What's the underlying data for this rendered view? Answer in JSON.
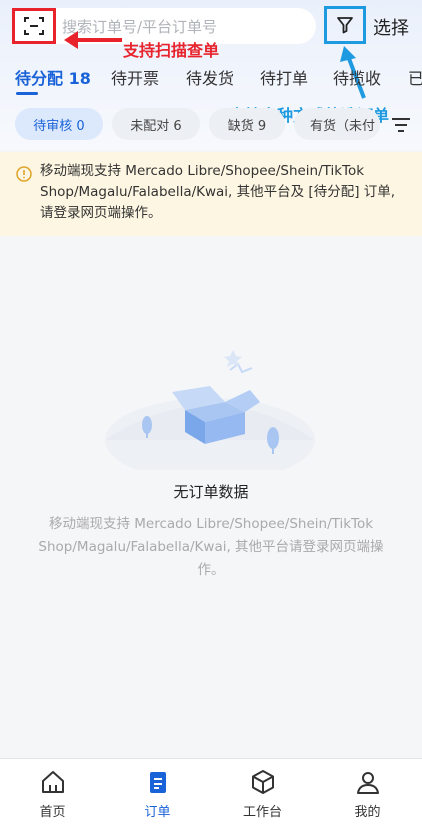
{
  "header": {
    "search_placeholder": "搜索订单号/平台订单号",
    "select_label": "选择",
    "scan_icon": "scan-icon",
    "filter_icon": "funnel-icon"
  },
  "annotations": {
    "scan_note": "支持扫描查单",
    "filter_note": "支持多种方式筛选订单"
  },
  "tabs": [
    {
      "label": "待分配 18",
      "active": true
    },
    {
      "label": "待开票"
    },
    {
      "label": "待发货"
    },
    {
      "label": "待打单"
    },
    {
      "label": "待揽收"
    },
    {
      "label": "已"
    }
  ],
  "chips": [
    {
      "label": "待审核 0",
      "active": true
    },
    {
      "label": "未配对 6"
    },
    {
      "label": "缺货 9"
    },
    {
      "label": "有货（未付"
    }
  ],
  "notice": {
    "text": "移动端现支持 Mercado Libre/Shopee/Shein/TikTok Shop/Magalu/Falabella/Kwai, 其他平台及 [待分配] 订单, 请登录网页端操作。"
  },
  "empty_state": {
    "title": "无订单数据",
    "description": "移动端现支持 Mercado Libre/Shopee/Shein/TikTok Shop/Magalu/Falabella/Kwai, 其他平台请登录网页端操作。"
  },
  "bottom_nav": [
    {
      "label": "首页",
      "icon": "home-icon"
    },
    {
      "label": "订单",
      "icon": "orders-icon",
      "active": true
    },
    {
      "label": "工作台",
      "icon": "workbench-icon"
    },
    {
      "label": "我的",
      "icon": "user-icon"
    }
  ],
  "colors": {
    "accent": "#1a62d8",
    "annotation_red": "#e8232b",
    "annotation_blue": "#1d9ae0",
    "notice_bg": "#fdf6e2"
  }
}
